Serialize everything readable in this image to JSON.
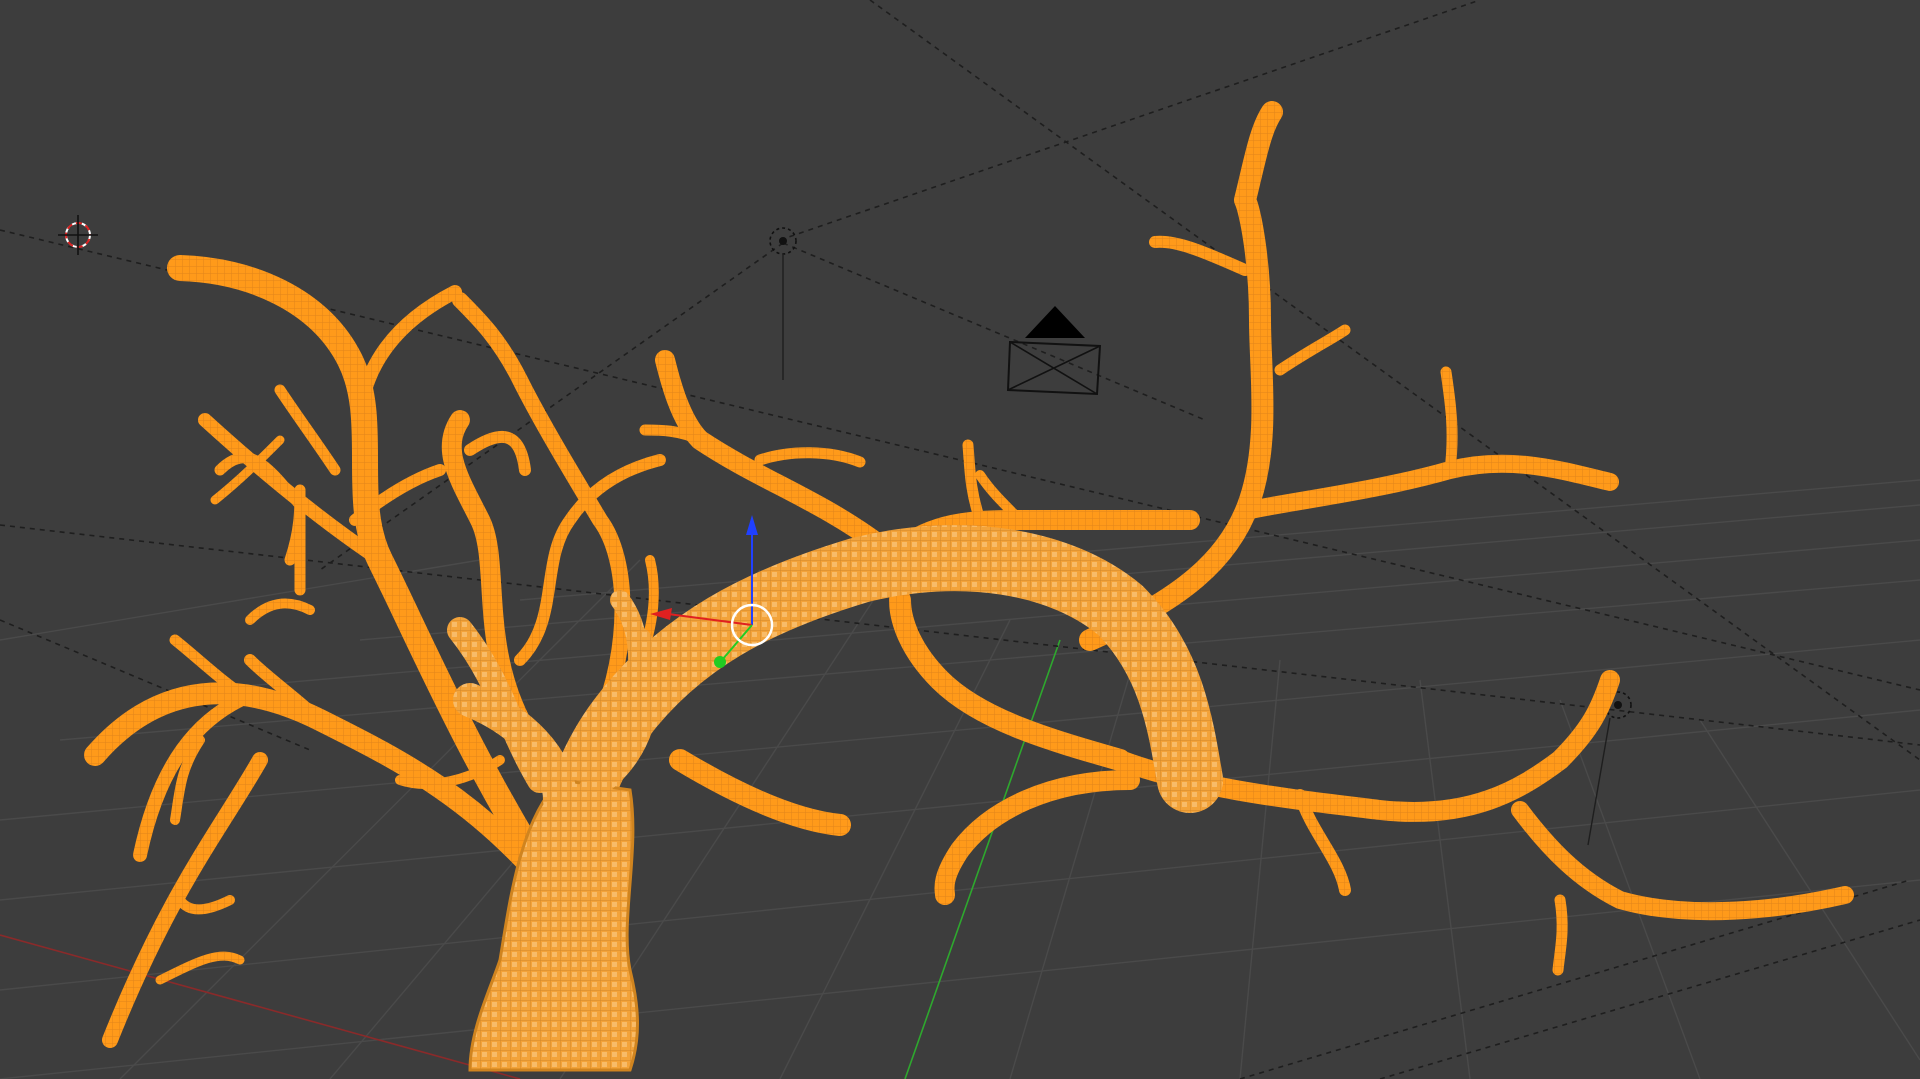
{
  "viewport": {
    "background_color": "#3d3d3d",
    "grid_color": "#4a4a4a",
    "selection_color": "#ff9a1a",
    "selection_edge_color": "#e08616",
    "relationship_line_color": "#1e1e1e"
  },
  "scene_objects": {
    "tree_mesh": {
      "selected": true,
      "icon": "mesh-object"
    },
    "camera": {
      "icon": "camera-icon"
    },
    "lamps": [
      {
        "icon": "lamp-icon"
      },
      {
        "icon": "lamp-icon"
      }
    ],
    "cursor_3d": {
      "icon": "3d-cursor-icon"
    }
  },
  "axes": {
    "x_color": "#cc2222",
    "y_color": "#2ea82e",
    "z_color": "#2a4bd0"
  },
  "transform_manipulator": {
    "icon": "translate-manipulator",
    "x_color": "#e02020",
    "y_color": "#22cc22",
    "z_color": "#2040ff"
  }
}
